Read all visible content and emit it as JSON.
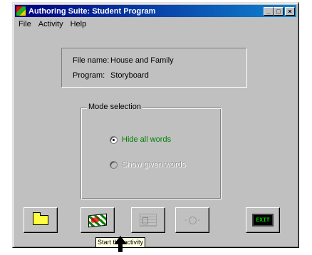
{
  "window": {
    "title": "Authoring Suite: Student Program"
  },
  "title_buttons": {
    "minimize": "_",
    "maximize": "□",
    "close": "×"
  },
  "menu": [
    {
      "label": "File"
    },
    {
      "label": "Activity"
    },
    {
      "label": "Help"
    }
  ],
  "info": {
    "file_label": "File name:",
    "file_value": "House and Family",
    "program_label": "Program:",
    "program_value": "Storyboard"
  },
  "mode": {
    "title": "Mode selection",
    "options": [
      {
        "label": "Hide all words",
        "selected": true,
        "enabled": true
      },
      {
        "label": "Show given words",
        "selected": false,
        "enabled": false
      }
    ]
  },
  "toolbar": {
    "buttons": [
      {
        "icon": "folder-open-icon",
        "enabled": true
      },
      {
        "icon": "checkered-flag-icon",
        "enabled": true
      },
      {
        "icon": "activity-cards-icon",
        "enabled": false
      },
      {
        "icon": "dial-icon",
        "enabled": false
      },
      {
        "icon": "exit-icon",
        "enabled": true,
        "text": "EXIT"
      }
    ]
  },
  "tooltip": "Start the activity",
  "colors": {
    "titlebar": "#000080",
    "selected_option": "#008000",
    "face": "#c0c0c0"
  }
}
